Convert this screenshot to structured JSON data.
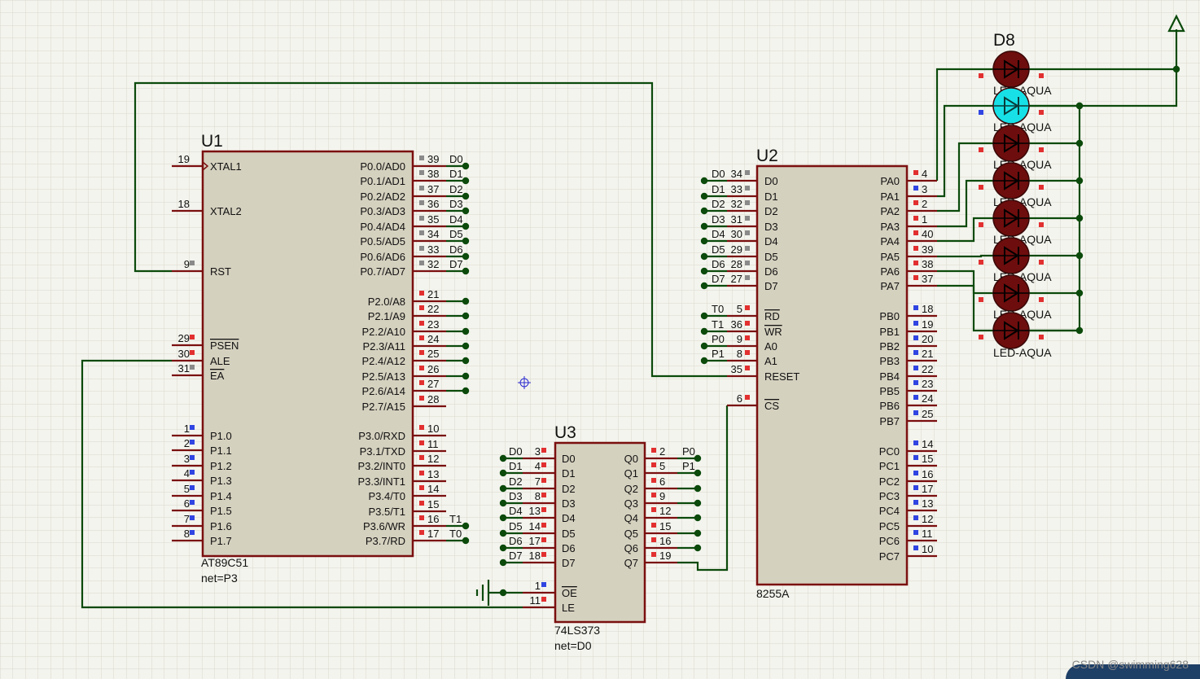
{
  "u1": {
    "ref": "U1",
    "part": "AT89C51",
    "net": "net=P3",
    "left_pins": [
      {
        "num": "19",
        "name": "XTAL1",
        "clock": true
      },
      {
        "num": "18",
        "name": "XTAL2"
      },
      {
        "num": "9",
        "name": "RST"
      },
      {
        "num": "29",
        "name": "PSEN",
        "overbar": true
      },
      {
        "num": "30",
        "name": "ALE"
      },
      {
        "num": "31",
        "name": "EA",
        "overbar": true
      },
      {
        "num": "1",
        "name": "P1.0"
      },
      {
        "num": "2",
        "name": "P1.1"
      },
      {
        "num": "3",
        "name": "P1.2"
      },
      {
        "num": "4",
        "name": "P1.3"
      },
      {
        "num": "5",
        "name": "P1.4"
      },
      {
        "num": "6",
        "name": "P1.5"
      },
      {
        "num": "7",
        "name": "P1.6"
      },
      {
        "num": "8",
        "name": "P1.7"
      }
    ],
    "right_pins": [
      {
        "num": "39",
        "name": "P0.0/AD0",
        "net": "D0"
      },
      {
        "num": "38",
        "name": "P0.1/AD1",
        "net": "D1"
      },
      {
        "num": "37",
        "name": "P0.2/AD2",
        "net": "D2"
      },
      {
        "num": "36",
        "name": "P0.3/AD3",
        "net": "D3"
      },
      {
        "num": "35",
        "name": "P0.4/AD4",
        "net": "D4"
      },
      {
        "num": "34",
        "name": "P0.5/AD5",
        "net": "D5"
      },
      {
        "num": "33",
        "name": "P0.6/AD6",
        "net": "D6"
      },
      {
        "num": "32",
        "name": "P0.7/AD7",
        "net": "D7"
      },
      {
        "num": "21",
        "name": "P2.0/A8"
      },
      {
        "num": "22",
        "name": "P2.1/A9"
      },
      {
        "num": "23",
        "name": "P2.2/A10"
      },
      {
        "num": "24",
        "name": "P2.3/A11"
      },
      {
        "num": "25",
        "name": "P2.4/A12"
      },
      {
        "num": "26",
        "name": "P2.5/A13"
      },
      {
        "num": "27",
        "name": "P2.6/A14"
      },
      {
        "num": "28",
        "name": "P2.7/A15"
      },
      {
        "num": "10",
        "name": "P3.0/RXD"
      },
      {
        "num": "11",
        "name": "P3.1/TXD"
      },
      {
        "num": "12",
        "name": "P3.2/INT0"
      },
      {
        "num": "13",
        "name": "P3.3/INT1"
      },
      {
        "num": "14",
        "name": "P3.4/T0"
      },
      {
        "num": "15",
        "name": "P3.5/T1"
      },
      {
        "num": "16",
        "name": "P3.6/WR",
        "net": "T1"
      },
      {
        "num": "17",
        "name": "P3.7/RD",
        "net": "T0"
      }
    ]
  },
  "u2": {
    "ref": "U2",
    "part": "8255A",
    "left_pins": [
      {
        "num": "34",
        "name": "D0",
        "net": "D0"
      },
      {
        "num": "33",
        "name": "D1",
        "net": "D1"
      },
      {
        "num": "32",
        "name": "D2",
        "net": "D2"
      },
      {
        "num": "31",
        "name": "D3",
        "net": "D3"
      },
      {
        "num": "30",
        "name": "D4",
        "net": "D4"
      },
      {
        "num": "29",
        "name": "D5",
        "net": "D5"
      },
      {
        "num": "28",
        "name": "D6",
        "net": "D6"
      },
      {
        "num": "27",
        "name": "D7",
        "net": "D7"
      },
      {
        "num": "5",
        "name": "RD",
        "net": "T0",
        "overbar": true
      },
      {
        "num": "36",
        "name": "WR",
        "net": "T1",
        "overbar": true
      },
      {
        "num": "9",
        "name": "A0",
        "net": "P0"
      },
      {
        "num": "8",
        "name": "A1",
        "net": "P1"
      },
      {
        "num": "35",
        "name": "RESET"
      },
      {
        "num": "6",
        "name": "CS",
        "overbar": true
      }
    ],
    "right_pins": [
      {
        "num": "4",
        "name": "PA0"
      },
      {
        "num": "3",
        "name": "PA1"
      },
      {
        "num": "2",
        "name": "PA2"
      },
      {
        "num": "1",
        "name": "PA3"
      },
      {
        "num": "40",
        "name": "PA4"
      },
      {
        "num": "39",
        "name": "PA5"
      },
      {
        "num": "38",
        "name": "PA6"
      },
      {
        "num": "37",
        "name": "PA7"
      },
      {
        "num": "18",
        "name": "PB0"
      },
      {
        "num": "19",
        "name": "PB1"
      },
      {
        "num": "20",
        "name": "PB2"
      },
      {
        "num": "21",
        "name": "PB3"
      },
      {
        "num": "22",
        "name": "PB4"
      },
      {
        "num": "23",
        "name": "PB5"
      },
      {
        "num": "24",
        "name": "PB6"
      },
      {
        "num": "25",
        "name": "PB7"
      },
      {
        "num": "14",
        "name": "PC0"
      },
      {
        "num": "15",
        "name": "PC1"
      },
      {
        "num": "16",
        "name": "PC2"
      },
      {
        "num": "17",
        "name": "PC3"
      },
      {
        "num": "13",
        "name": "PC4"
      },
      {
        "num": "12",
        "name": "PC5"
      },
      {
        "num": "11",
        "name": "PC6"
      },
      {
        "num": "10",
        "name": "PC7"
      }
    ]
  },
  "u3": {
    "ref": "U3",
    "part": "74LS373",
    "net": "net=D0",
    "left_pins": [
      {
        "num": "3",
        "name": "D0",
        "net": "D0"
      },
      {
        "num": "4",
        "name": "D1",
        "net": "D1"
      },
      {
        "num": "7",
        "name": "D2",
        "net": "D2"
      },
      {
        "num": "8",
        "name": "D3",
        "net": "D3"
      },
      {
        "num": "13",
        "name": "D4",
        "net": "D4"
      },
      {
        "num": "14",
        "name": "D5",
        "net": "D5"
      },
      {
        "num": "17",
        "name": "D6",
        "net": "D6"
      },
      {
        "num": "18",
        "name": "D7",
        "net": "D7"
      },
      {
        "num": "1",
        "name": "OE",
        "overbar": true
      },
      {
        "num": "11",
        "name": "LE"
      }
    ],
    "right_pins": [
      {
        "num": "2",
        "name": "Q0",
        "net": "P0"
      },
      {
        "num": "5",
        "name": "Q1",
        "net": "P1"
      },
      {
        "num": "6",
        "name": "Q2"
      },
      {
        "num": "9",
        "name": "Q3"
      },
      {
        "num": "12",
        "name": "Q4"
      },
      {
        "num": "15",
        "name": "Q5"
      },
      {
        "num": "16",
        "name": "Q6"
      },
      {
        "num": "19",
        "name": "Q7"
      }
    ]
  },
  "leds": {
    "ref": "D8",
    "labels": [
      "LED-AQUA",
      "LED-AQUA",
      "LED-AQUA",
      "LED-AQUA",
      "LED-AQUA",
      "LED-AQUA",
      "LED-AQUA",
      "LED-AQUA"
    ],
    "lit": [
      false,
      true,
      false,
      false,
      false,
      false,
      false,
      false
    ]
  },
  "watermark": "CSDN @swimming628",
  "colors": {
    "wire": "#0b4a0b",
    "body": "#d5d1bf",
    "outline": "#7a0f0f",
    "led_off": "#6e0d0d",
    "led_on": "#17e1e6",
    "pin_red": "#e23030",
    "pin_blue": "#3045e2",
    "pin_gray": "#8a8a8a",
    "grid": "#dcdcd0"
  }
}
